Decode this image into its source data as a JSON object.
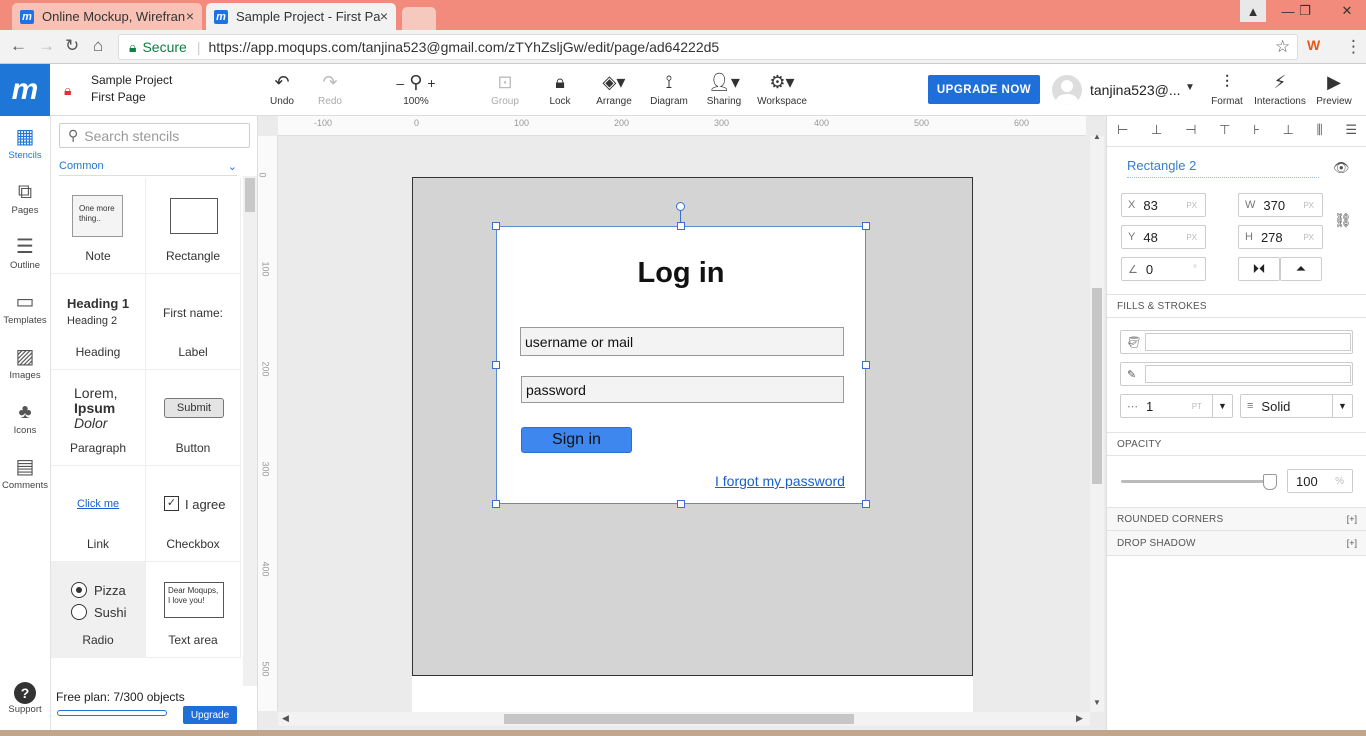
{
  "browser": {
    "tabs": [
      {
        "label": "Online Mockup, Wirefran",
        "close": "×"
      },
      {
        "label": "Sample Project - First Pa",
        "close": "×"
      }
    ],
    "secure_label": "Secure",
    "url": "https://app.moqups.com/tanjina523@gmail.com/zTYhZsljGw/edit/page/ad64222d5"
  },
  "app": {
    "logo": "m",
    "project_name": "Sample Project",
    "page_name": "First Page",
    "toolbar": [
      {
        "label": "Undo",
        "icon": "undo-icon",
        "enabled": true
      },
      {
        "label": "Redo",
        "icon": "redo-icon",
        "enabled": false
      },
      {
        "label": "100%",
        "icon": "zoom-icon",
        "enabled": true
      },
      {
        "label": "Group",
        "icon": "group-icon",
        "enabled": false
      },
      {
        "label": "Lock",
        "icon": "lock-icon",
        "enabled": true
      },
      {
        "label": "Arrange",
        "icon": "arrange-icon",
        "enabled": true
      },
      {
        "label": "Diagram",
        "icon": "diagram-icon",
        "enabled": true
      },
      {
        "label": "Sharing",
        "icon": "sharing-icon",
        "enabled": true
      },
      {
        "label": "Workspace",
        "icon": "workspace-icon",
        "enabled": true
      }
    ],
    "zoom_minus": "–",
    "zoom_plus": "+",
    "upgrade_label": "UPGRADE NOW",
    "user": "tanjina523@...",
    "right_tools": [
      {
        "label": "Format",
        "icon": "format-icon"
      },
      {
        "label": "Interactions",
        "icon": "interactions-icon"
      },
      {
        "label": "Preview",
        "icon": "preview-icon"
      }
    ]
  },
  "rail": [
    {
      "label": "Stencils",
      "icon": "stencils-icon",
      "active": true
    },
    {
      "label": "Pages",
      "icon": "pages-icon"
    },
    {
      "label": "Outline",
      "icon": "outline-icon"
    },
    {
      "label": "Templates",
      "icon": "templates-icon"
    },
    {
      "label": "Images",
      "icon": "images-icon"
    },
    {
      "label": "Icons",
      "icon": "icons-icon"
    },
    {
      "label": "Comments",
      "icon": "comments-icon"
    },
    {
      "label": "Support",
      "icon": "support-icon"
    }
  ],
  "stencils": {
    "search_placeholder": "Search stencils",
    "category": "Common",
    "items": [
      {
        "label": "Note",
        "preview": "One more thing.."
      },
      {
        "label": "Rectangle",
        "preview": ""
      },
      {
        "label": "Heading",
        "preview": "Heading 1",
        "preview2": "Heading 2"
      },
      {
        "label": "Label",
        "preview": "First name:"
      },
      {
        "label": "Paragraph",
        "preview": "Lorem,",
        "preview2": "Ipsum",
        "preview3": "Dolor"
      },
      {
        "label": "Button",
        "preview": "Submit"
      },
      {
        "label": "Link",
        "preview": "Click me"
      },
      {
        "label": "Checkbox",
        "preview": "I agree"
      },
      {
        "label": "Radio",
        "preview": "Pizza",
        "preview2": "Sushi"
      },
      {
        "label": "Text area",
        "preview": "Dear Moqups, I love you!"
      }
    ],
    "plan_text": "Free plan: 7/300 objects",
    "plan_upgrade": "Upgrade"
  },
  "rulers": {
    "h": [
      "-100",
      "0",
      "100",
      "200",
      "300",
      "400",
      "500",
      "600"
    ],
    "v": [
      "0",
      "100",
      "200",
      "300",
      "400",
      "500"
    ]
  },
  "mockup": {
    "title": "Log  in",
    "username_placeholder": "username or mail",
    "password_placeholder": "password",
    "signin_label": "Sign in",
    "forgot_label": "I forgot my password"
  },
  "properties": {
    "shape_name": "Rectangle 2",
    "x": "83",
    "y": "48",
    "w": "370",
    "h": "278",
    "angle": "0",
    "x_label": "X",
    "y_label": "Y",
    "w_label": "W",
    "h_label": "H",
    "unit": "PX",
    "deg": "°",
    "fills_header": "FILLS & STROKES",
    "stroke_width": "1",
    "stroke_unit": "PT",
    "stroke_style": "Solid",
    "opacity_header": "OPACITY",
    "opacity": "100",
    "opacity_unit": "%",
    "rounded_header": "ROUNDED CORNERS",
    "shadow_header": "DROP SHADOW",
    "expand": "[+]"
  }
}
